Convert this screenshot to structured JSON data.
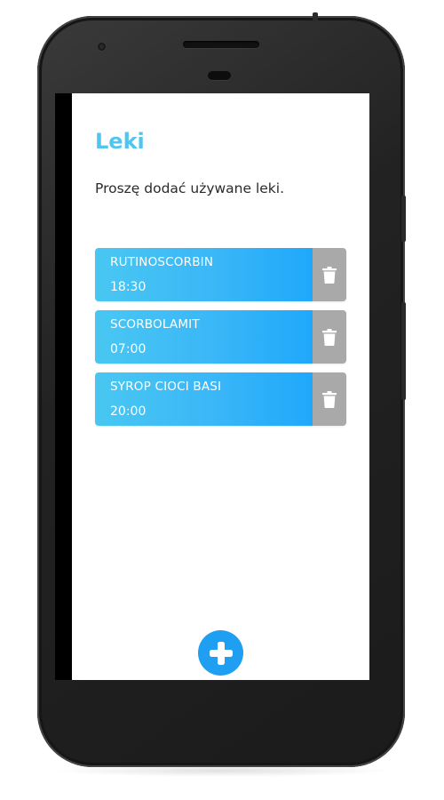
{
  "app": {
    "title": "Leki",
    "subtitle": "Proszę dodać używane leki."
  },
  "medications": [
    {
      "name": "RUTINOSCORBIN",
      "time": "18:30"
    },
    {
      "name": "SCORBOLAMIT",
      "time": "07:00"
    },
    {
      "name": "SYROP CIOCI BASI",
      "time": "20:00"
    }
  ],
  "icons": {
    "delete": "trash-icon",
    "add": "plus-icon"
  },
  "colors": {
    "title": "#4ec6f0",
    "item_gradient_start": "#49c7f2",
    "item_gradient_end": "#1fa8fb",
    "delete_bg": "#a9a9a9",
    "add_button": "#1e9ff2"
  }
}
